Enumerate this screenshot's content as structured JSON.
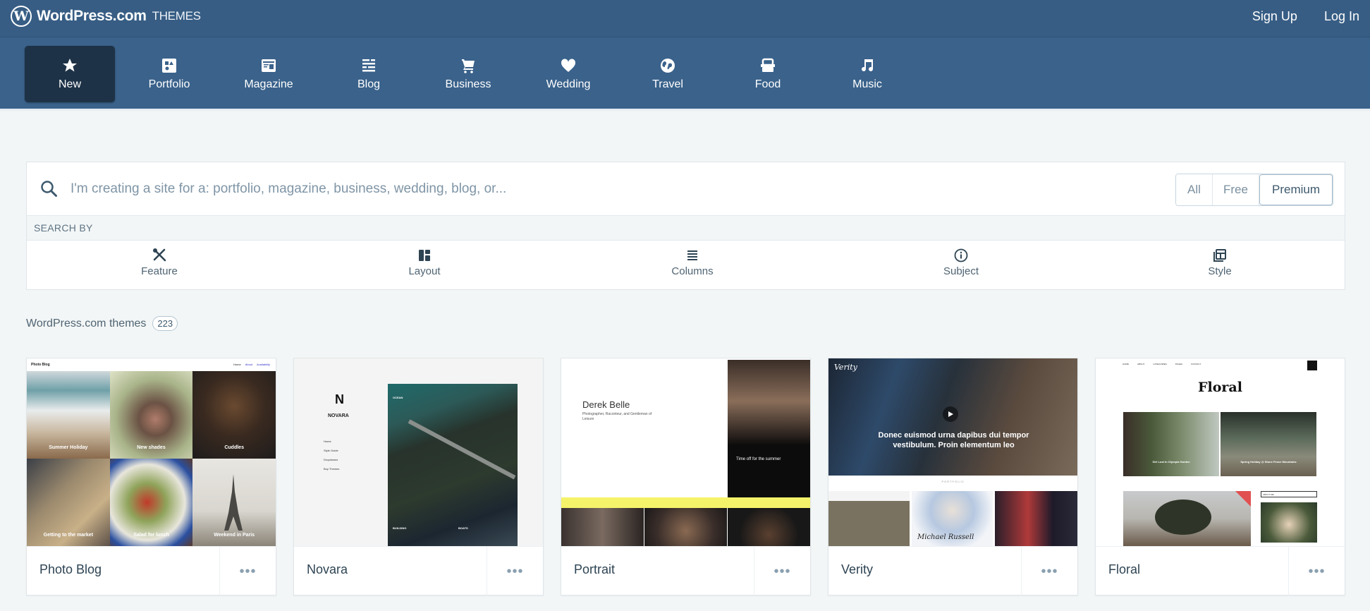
{
  "header": {
    "logo_mark": "W",
    "brand": "WordPress.com",
    "section": "THEMES",
    "links": [
      {
        "label": "Sign Up"
      },
      {
        "label": "Log In"
      }
    ]
  },
  "categories": [
    {
      "label": "New",
      "icon": "star-icon",
      "active": true
    },
    {
      "label": "Portfolio",
      "icon": "portfolio-icon",
      "active": false
    },
    {
      "label": "Magazine",
      "icon": "magazine-icon",
      "active": false
    },
    {
      "label": "Blog",
      "icon": "blog-icon",
      "active": false
    },
    {
      "label": "Business",
      "icon": "cart-icon",
      "active": false
    },
    {
      "label": "Wedding",
      "icon": "heart-icon",
      "active": false
    },
    {
      "label": "Travel",
      "icon": "globe-icon",
      "active": false
    },
    {
      "label": "Food",
      "icon": "basket-icon",
      "active": false
    },
    {
      "label": "Music",
      "icon": "music-note-icon",
      "active": false
    }
  ],
  "search": {
    "placeholder": "I'm creating a site for a: portfolio, magazine, business, wedding, blog, or...",
    "value": "",
    "filters": [
      {
        "label": "All"
      },
      {
        "label": "Free"
      },
      {
        "label": "Premium",
        "selected": true
      }
    ],
    "search_by_label": "SEARCH BY",
    "facets": [
      {
        "label": "Feature",
        "icon": "tools-icon"
      },
      {
        "label": "Layout",
        "icon": "layout-icon"
      },
      {
        "label": "Columns",
        "icon": "columns-icon"
      },
      {
        "label": "Subject",
        "icon": "info-icon"
      },
      {
        "label": "Style",
        "icon": "style-icon"
      }
    ]
  },
  "results": {
    "label": "WordPress.com themes",
    "count": "223"
  },
  "themes": [
    {
      "name": "Photo Blog",
      "more": "•••",
      "preview": {
        "site_title": "Photo Blog",
        "nav": [
          "Home",
          "About",
          "Availability"
        ],
        "captions": [
          "Summer Holiday",
          "New shades",
          "Cuddles",
          "Getting to the market",
          "Salad for lunch",
          "Weekend in Paris"
        ]
      }
    },
    {
      "name": "Novara",
      "more": "•••",
      "preview": {
        "logo": "N",
        "site_title": "NOVARA",
        "menu": [
          "Home",
          "Style Guide",
          "Dropdowns",
          "Buy Themes"
        ],
        "captions": [
          "OCEAN",
          "BUILDING",
          "BOATS"
        ]
      }
    },
    {
      "name": "Portrait",
      "more": "•••",
      "preview": {
        "site_title": "Derek Belle",
        "tagline": "Photographer, Raconteur, and Gentleman of Leisure",
        "post_title": "Time off for the summer"
      }
    },
    {
      "name": "Verity",
      "more": "•••",
      "preview": {
        "logo": "Verity",
        "headline": "Donec euismod urna dapibus dui tempor vestibulum. Proin elementum leo",
        "section": "PORTFOLIO",
        "signature": "Michael Russell"
      }
    },
    {
      "name": "Floral",
      "more": "•••",
      "preview": {
        "site_title": "Floral",
        "nav": [
          "HOME",
          "ABOUT",
          "CATEGORIES",
          "PAGES",
          "CONTACT"
        ],
        "captions": [
          "Girl Lost in Olympia Garden",
          "Spring Holiday @ Stone Fence Mountains"
        ],
        "widget": "ABOUT ME"
      }
    }
  ]
}
